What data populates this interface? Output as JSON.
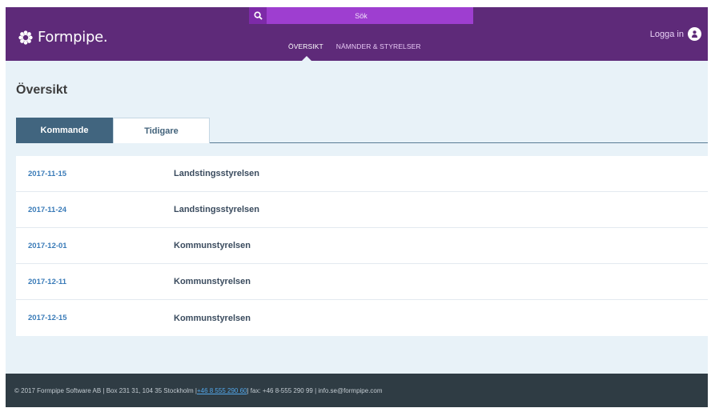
{
  "brand": {
    "name": "Formpipe."
  },
  "search": {
    "label": "Sök"
  },
  "nav": [
    {
      "label": "ÖVERSIKT",
      "active": true
    },
    {
      "label": "NÄMNDER & STYRELSER",
      "active": false
    }
  ],
  "login": {
    "label": "Logga in"
  },
  "page": {
    "title": "Översikt"
  },
  "tabs": [
    {
      "label": "Kommande",
      "active": true
    },
    {
      "label": "Tidigare",
      "active": false
    }
  ],
  "meetings": [
    {
      "date": "2017-11-15",
      "body": "Landstingsstyrelsen"
    },
    {
      "date": "2017-11-24",
      "body": "Landstingsstyrelsen"
    },
    {
      "date": "2017-12-01",
      "body": "Kommunstyrelsen"
    },
    {
      "date": "2017-12-11",
      "body": "Kommunstyrelsen"
    },
    {
      "date": "2017-12-15",
      "body": "Kommunstyrelsen"
    }
  ],
  "footer": {
    "prefix": "© 2017 Formpipe Software AB | Box 231 31, 104 35 Stockholm | ",
    "phone": "+46 8 555 290 60",
    "suffix": " | fax: +46 8-555 290 99 | info.se@formpipe.com"
  },
  "colors": {
    "header": "#5e2a79",
    "search": "#9e3ed0",
    "active_tab": "#41657f",
    "background": "#e8f2f8",
    "footer": "#2f3c44",
    "date_link": "#3a7bb8"
  },
  "icons": {
    "search": "search-icon",
    "user": "user-icon",
    "logo": "formpipe-logo-icon"
  }
}
